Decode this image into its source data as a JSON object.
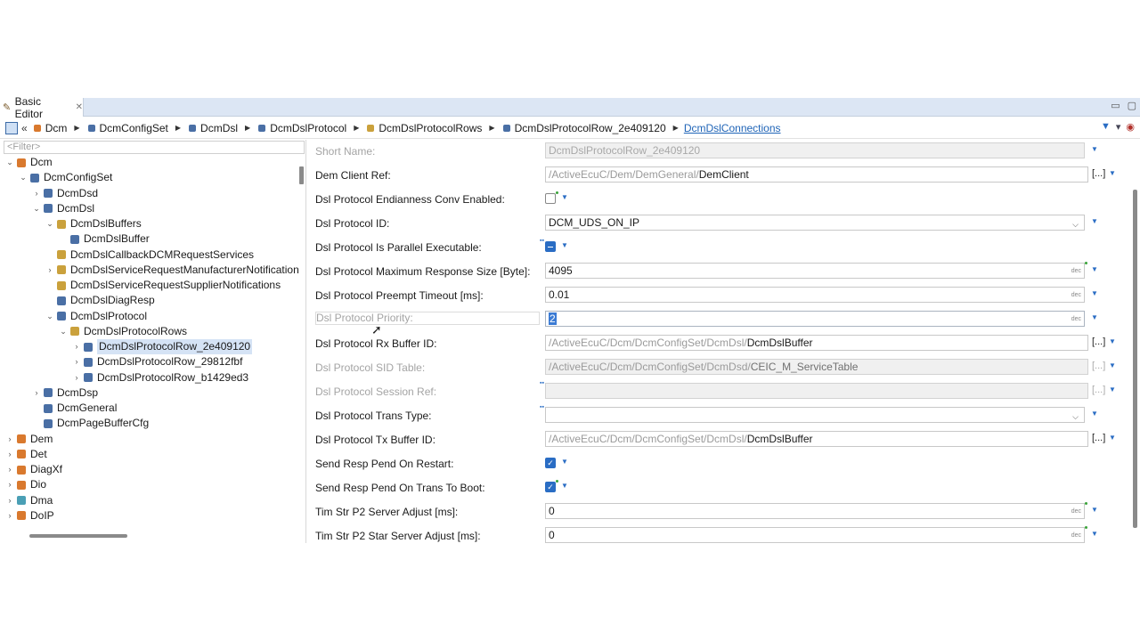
{
  "tab": {
    "label": "Basic Editor",
    "close": "✕"
  },
  "window_buttons": {
    "minimize": "▭",
    "maximize": "▢"
  },
  "breadcrumb": {
    "back": "«",
    "items": [
      {
        "label": "Dcm",
        "icon": "fox"
      },
      {
        "label": "DcmConfigSet",
        "icon": "blue"
      },
      {
        "label": "DcmDsl",
        "icon": "blue"
      },
      {
        "label": "DcmDslProtocol",
        "icon": "blue"
      },
      {
        "label": "DcmDslProtocolRows",
        "icon": "folder"
      },
      {
        "label": "DcmDslProtocolRow_2e409120",
        "icon": "blue"
      },
      {
        "label": "DcmDslConnections",
        "icon": "",
        "link": true
      }
    ],
    "tools": {
      "filter": "▼",
      "menu": "▾",
      "shield": "◉"
    }
  },
  "tree": {
    "filter_placeholder": "<Filter>",
    "items": [
      {
        "label": "Dcm",
        "indent": 0,
        "twisty": "⌄",
        "icon": "fox"
      },
      {
        "label": "DcmConfigSet",
        "indent": 1,
        "twisty": "⌄",
        "icon": "blue"
      },
      {
        "label": "DcmDsd",
        "indent": 2,
        "twisty": "›",
        "icon": "blue"
      },
      {
        "label": "DcmDsl",
        "indent": 2,
        "twisty": "⌄",
        "icon": "blue"
      },
      {
        "label": "DcmDslBuffers",
        "indent": 3,
        "twisty": "⌄",
        "icon": "folder"
      },
      {
        "label": "DcmDslBuffer",
        "indent": 4,
        "twisty": "",
        "icon": "blue"
      },
      {
        "label": "DcmDslCallbackDCMRequestServices",
        "indent": 3,
        "twisty": "",
        "icon": "folder"
      },
      {
        "label": "DcmDslServiceRequestManufacturerNotifications",
        "indent": 3,
        "twisty": "›",
        "icon": "folder"
      },
      {
        "label": "DcmDslServiceRequestSupplierNotifications",
        "indent": 3,
        "twisty": "",
        "icon": "folder"
      },
      {
        "label": "DcmDslDiagResp",
        "indent": 3,
        "twisty": "",
        "icon": "blue"
      },
      {
        "label": "DcmDslProtocol",
        "indent": 3,
        "twisty": "⌄",
        "icon": "blue"
      },
      {
        "label": "DcmDslProtocolRows",
        "indent": 4,
        "twisty": "⌄",
        "icon": "folder"
      },
      {
        "label": "DcmDslProtocolRow_2e409120",
        "indent": 5,
        "twisty": "›",
        "icon": "blue",
        "selected": true
      },
      {
        "label": "DcmDslProtocolRow_29812fbf",
        "indent": 5,
        "twisty": "›",
        "icon": "blue"
      },
      {
        "label": "DcmDslProtocolRow_b1429ed3",
        "indent": 5,
        "twisty": "›",
        "icon": "blue"
      },
      {
        "label": "DcmDsp",
        "indent": 2,
        "twisty": "›",
        "icon": "blue"
      },
      {
        "label": "DcmGeneral",
        "indent": 2,
        "twisty": "",
        "icon": "blue"
      },
      {
        "label": "DcmPageBufferCfg",
        "indent": 2,
        "twisty": "",
        "icon": "blue"
      },
      {
        "label": "Dem",
        "indent": 0,
        "twisty": "›",
        "icon": "fox"
      },
      {
        "label": "Det",
        "indent": 0,
        "twisty": "›",
        "icon": "fox"
      },
      {
        "label": "DiagXf",
        "indent": 0,
        "twisty": "›",
        "icon": "fox"
      },
      {
        "label": "Dio",
        "indent": 0,
        "twisty": "›",
        "icon": "fox"
      },
      {
        "label": "Dma",
        "indent": 0,
        "twisty": "›",
        "icon": "cyan"
      },
      {
        "label": "DoIP",
        "indent": 0,
        "twisty": "›",
        "icon": "fox"
      }
    ]
  },
  "form": {
    "short_name": {
      "label": "Short Name:",
      "value": "DcmDslProtocolRow_2e409120"
    },
    "dem_client_ref": {
      "label": "Dem Client Ref:",
      "prefix": "/ActiveEcuC/Dem/DemGeneral/",
      "value": "DemClient"
    },
    "endianness": {
      "label": "Dsl Protocol Endianness Conv Enabled:",
      "checked": false
    },
    "protocol_id": {
      "label": "Dsl Protocol ID:",
      "value": "DCM_UDS_ON_IP"
    },
    "parallel": {
      "label": "Dsl Protocol Is Parallel Executable:"
    },
    "max_resp": {
      "label": "Dsl Protocol Maximum Response Size [Byte]:",
      "value": "4095"
    },
    "preempt": {
      "label": "Dsl Protocol Preempt Timeout [ms]:",
      "value": "0.01"
    },
    "priority": {
      "label": "Dsl Protocol Priority:",
      "value": "2"
    },
    "rx_buffer": {
      "label": "Dsl Protocol Rx Buffer ID:",
      "prefix": "/ActiveEcuC/Dcm/DcmConfigSet/DcmDsl/",
      "value": "DcmDslBuffer"
    },
    "sid_table": {
      "label": "Dsl Protocol SID Table:",
      "prefix": "/ActiveEcuC/Dcm/DcmConfigSet/DcmDsd/",
      "value": "CEIC_M_ServiceTable"
    },
    "session_ref": {
      "label": "Dsl Protocol Session Ref:",
      "value": ""
    },
    "trans_type": {
      "label": "Dsl Protocol Trans Type:",
      "value": ""
    },
    "tx_buffer": {
      "label": "Dsl Protocol Tx Buffer ID:",
      "prefix": "/ActiveEcuC/Dcm/DcmConfigSet/DcmDsl/",
      "value": "DcmDslBuffer"
    },
    "resp_pend_restart": {
      "label": "Send Resp Pend On Restart:",
      "checked": true
    },
    "resp_pend_boot": {
      "label": "Send Resp Pend On Trans To Boot:",
      "checked": true
    },
    "p2_adjust": {
      "label": "Tim Str P2 Server Adjust [ms]:",
      "value": "0"
    },
    "p2_star_adjust": {
      "label": "Tim Str P2 Star Server Adjust [ms]:",
      "value": "0"
    },
    "dec_tag": "dec",
    "dots": "[...]",
    "arrow": "▼",
    "combo_chevron": "⌵",
    "check": "✓"
  },
  "colors": {
    "accent": "#2a6dc4",
    "tab_bar": "#dce6f4",
    "selection": "#d5e3f5"
  }
}
